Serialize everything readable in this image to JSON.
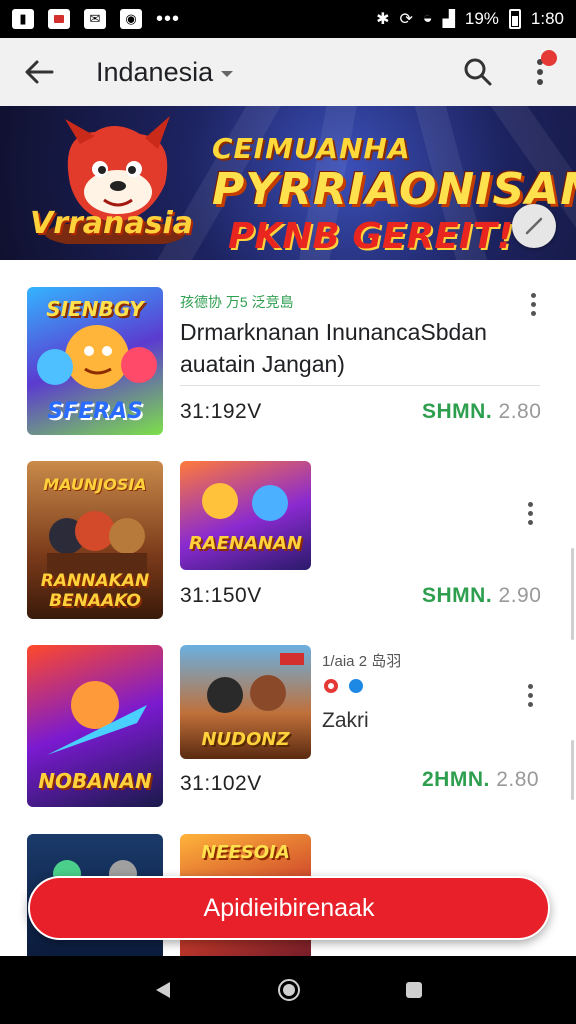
{
  "status_bar": {
    "time": "1:80",
    "battery": "19%"
  },
  "app_bar": {
    "title": "Indanesia"
  },
  "banner": {
    "line1": "CEIMUANHA",
    "line2": "PYRRIAONISAN",
    "line3": "PKNB GEREIT!",
    "logo_text": "Vrranasia"
  },
  "cards": [
    {
      "thumb_label": "SFERAS",
      "thumb_top_label": "SIENBGY",
      "tagline": "孩德协 万5 泛竞島",
      "title_line1": "Drmarknanan InunancaSbdan",
      "title_line2": "auatain Jangan)",
      "price": "31:192V",
      "price_green": "SHMN.",
      "price_green_dim": "2.80"
    },
    {
      "thumb_left_label": "RANNAKAN BENAAKO",
      "thumb_left_top": "MAUNJOSIA",
      "thumb_right_label": "RAENANAN",
      "price": "31:150V",
      "price_green": "SHMN.",
      "price_green_dim": "2.90"
    },
    {
      "thumb_left_label": "NOBANAN",
      "thumb_right_label": "NUDONZ",
      "small_text": "1/aia 2 岛羽",
      "zakri": "Zakri",
      "price": "31:102V",
      "price_green": "2HMN.",
      "price_green_dim": "2.80"
    },
    {
      "thumb_right_label": "NEESOIA"
    }
  ],
  "cta": {
    "label": "Apidieibirenaak"
  },
  "colors": {
    "accent_red": "#e8202a",
    "price_green": "#2e9e4f",
    "app_bar_bg": "#f1f1f1"
  }
}
